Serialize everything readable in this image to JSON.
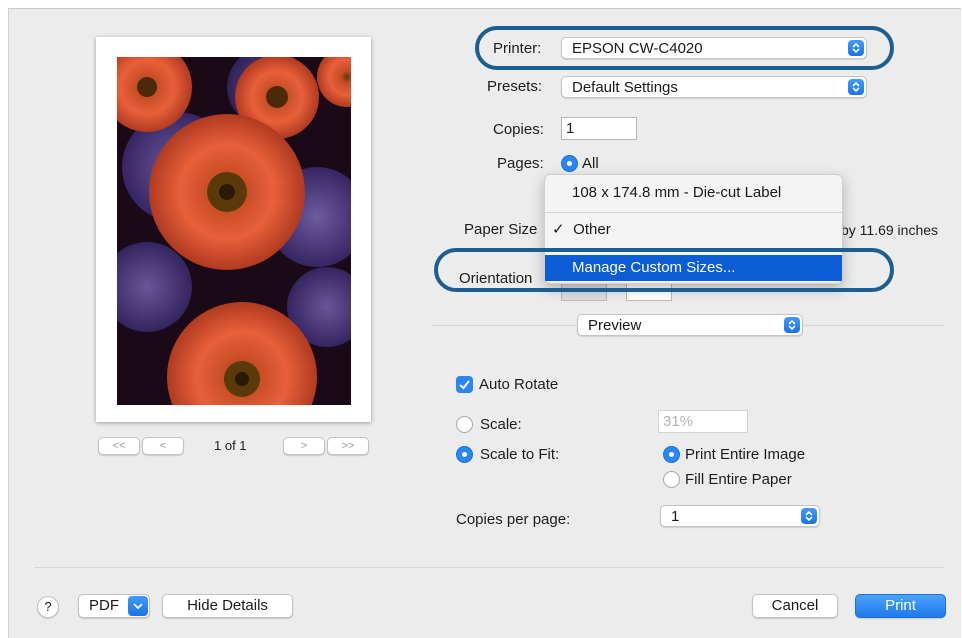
{
  "printer": {
    "label": "Printer:",
    "value": "EPSON CW-C4020"
  },
  "presets": {
    "label": "Presets:",
    "value": "Default Settings"
  },
  "copies": {
    "label": "Copies:",
    "value": "1"
  },
  "pages": {
    "label": "Pages:",
    "option_all": "All"
  },
  "paper_size": {
    "label": "Paper Size",
    "suffix": "by 11.69 inches"
  },
  "orientation": {
    "label": "Orientation"
  },
  "dropdown_menu": {
    "items": [
      {
        "label": "108 x 174.8 mm - Die-cut Label",
        "checked": false
      },
      {
        "label": "Other",
        "checked": true
      },
      {
        "label": "Manage Custom Sizes...",
        "selected": true
      }
    ],
    "check_mark": "✓"
  },
  "section_popup": {
    "value": "Preview"
  },
  "auto_rotate": {
    "label": "Auto Rotate",
    "checked": true
  },
  "scale": {
    "label": "Scale:",
    "value": "31%"
  },
  "scale_to_fit": {
    "label": "Scale to Fit:",
    "option_entire_image": "Print Entire Image",
    "option_fill_paper": "Fill Entire Paper"
  },
  "copies_per_page": {
    "label": "Copies per page:",
    "value": "1"
  },
  "preview_nav": {
    "page_indicator": "1 of 1",
    "first": "<<",
    "prev": "<",
    "next": ">",
    "last": ">>"
  },
  "footer": {
    "help": "?",
    "pdf": "PDF",
    "hide_details": "Hide Details",
    "cancel": "Cancel",
    "print": "Print"
  },
  "colors": {
    "accent": "#2a86f0",
    "highlight_ring": "#1c5e92",
    "menu_selected": "#0b5cd5"
  }
}
